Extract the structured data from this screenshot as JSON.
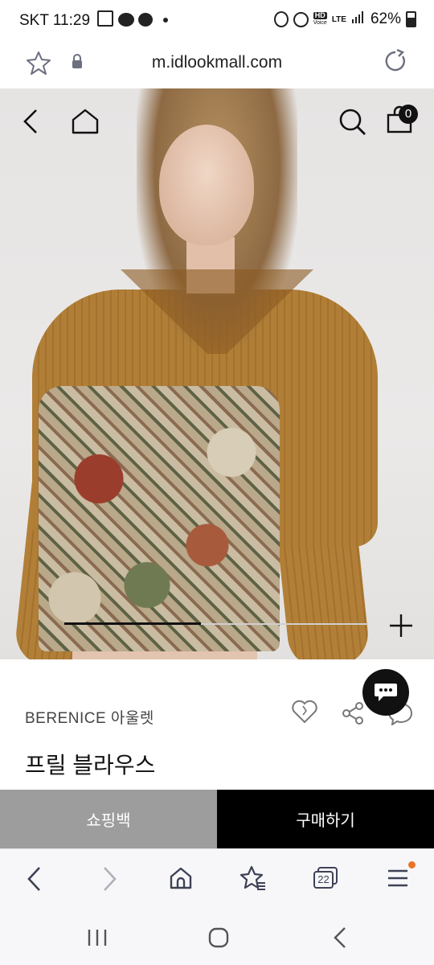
{
  "status_bar": {
    "carrier": "SKT",
    "time": "11:29",
    "hd_label": "HD",
    "hd_sub": "Voice",
    "network": "LTE",
    "battery": "62%"
  },
  "url_bar": {
    "url": "m.idlookmall.com"
  },
  "hero": {
    "cart_count": "0",
    "image_progress": 0.45
  },
  "product": {
    "brand": "BERENICE 아울렛",
    "name": "프릴 블라우스"
  },
  "actions": {
    "shopping_bag": "쇼핑백",
    "buy": "구매하기"
  },
  "browser_toolbar": {
    "tabs_count": "22"
  },
  "colors": {
    "buy_button": "#000000",
    "bag_button": "#9d9d9d",
    "notification_dot": "#e8742c"
  }
}
